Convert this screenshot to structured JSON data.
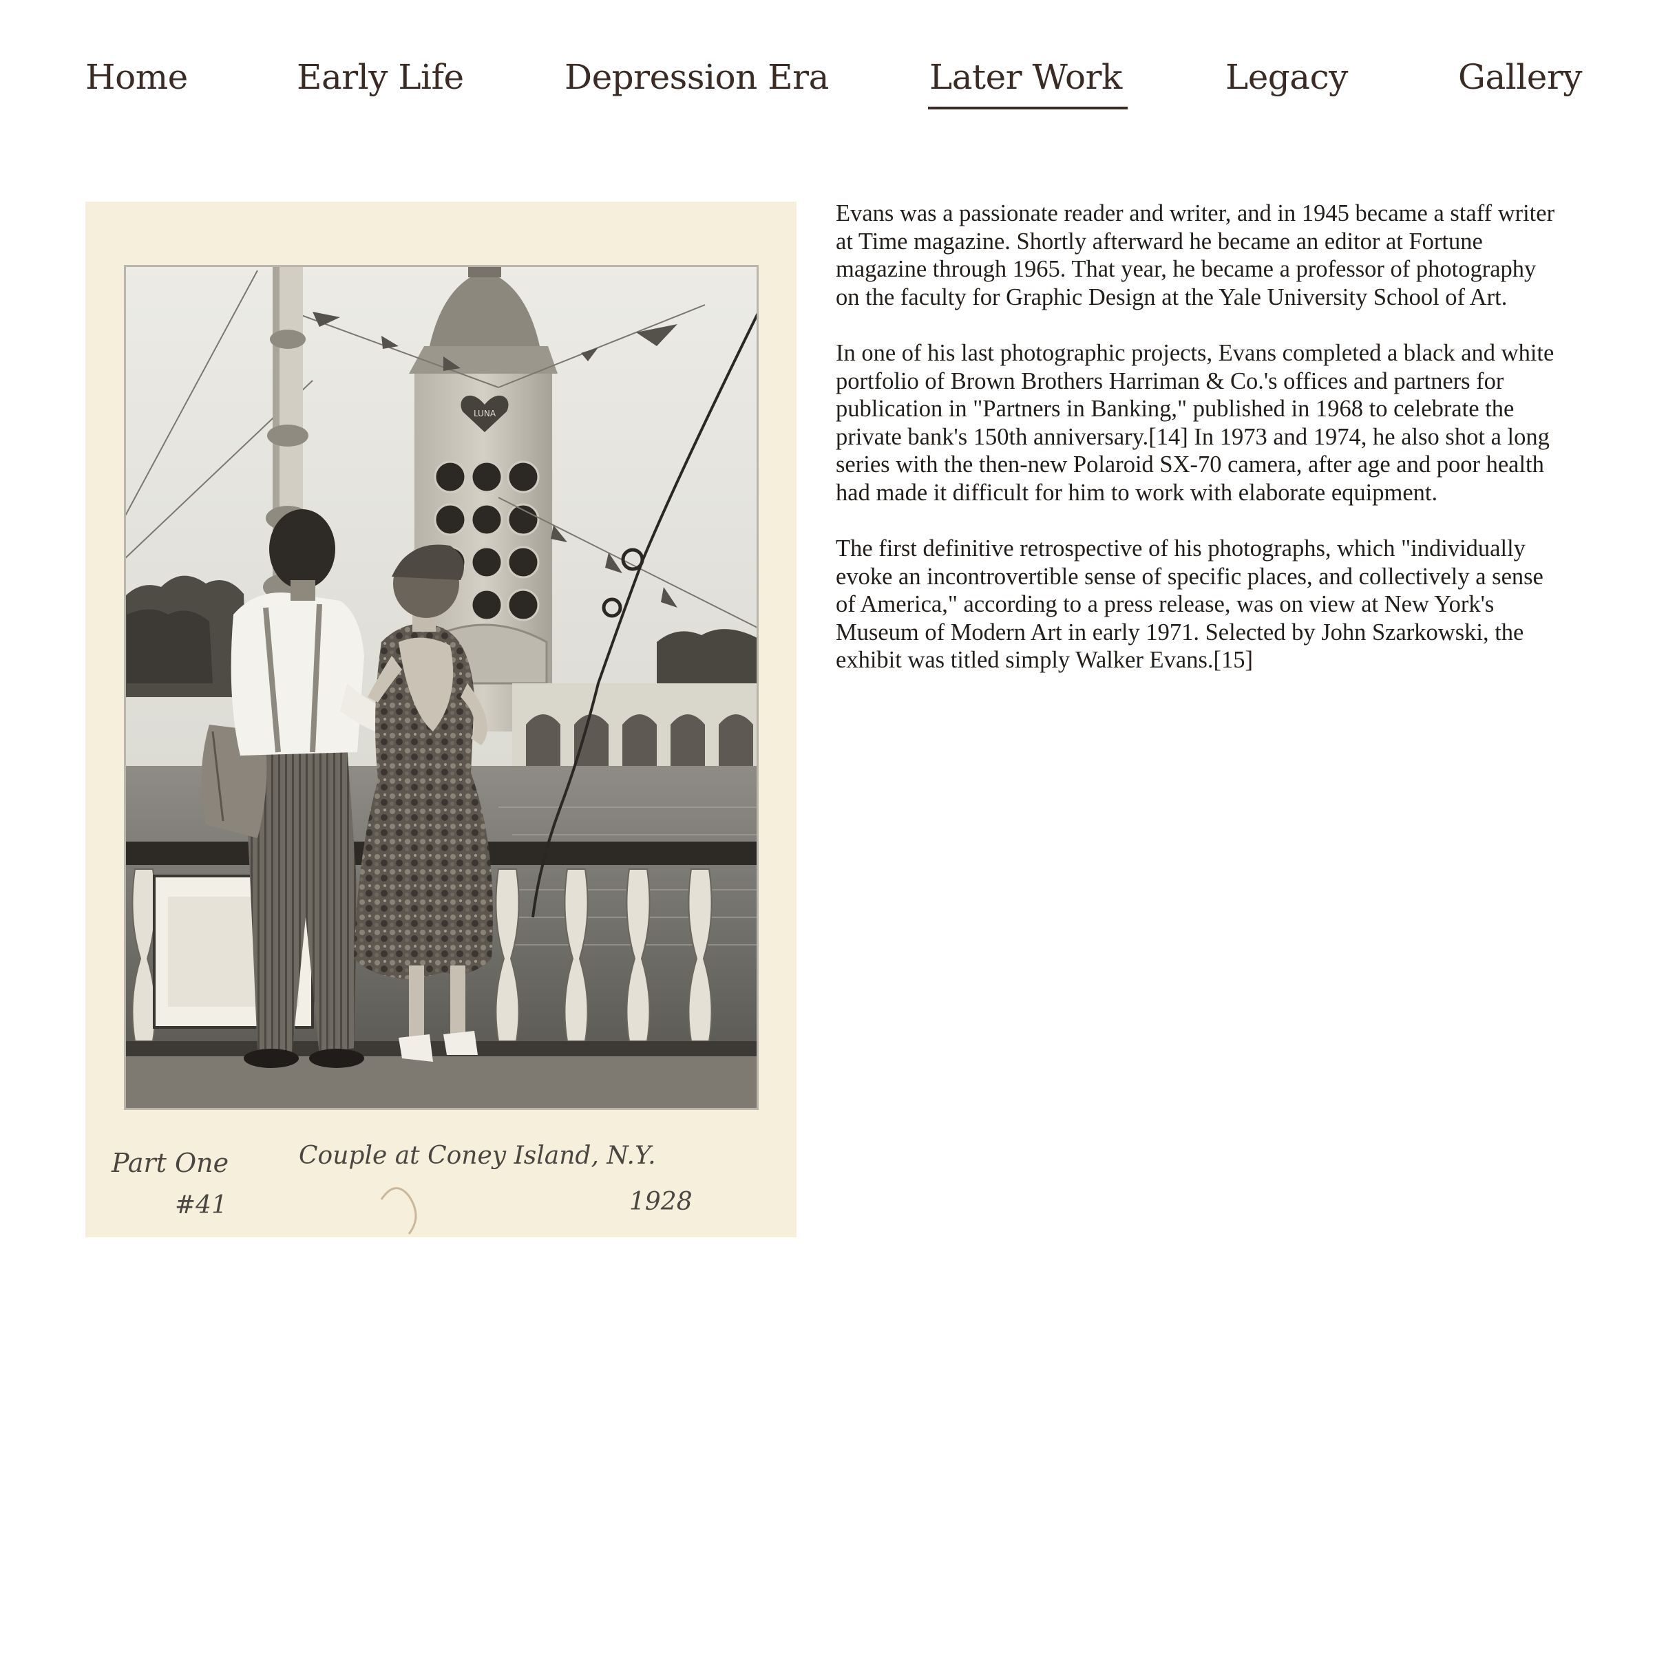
{
  "nav": {
    "items": [
      {
        "id": "home",
        "label": "Home",
        "active": false
      },
      {
        "id": "early-life",
        "label": "Early Life",
        "active": false
      },
      {
        "id": "depression-era",
        "label": "Depression Era",
        "active": false
      },
      {
        "id": "later-work",
        "label": "Later Work",
        "active": true
      },
      {
        "id": "legacy",
        "label": "Legacy",
        "active": false
      },
      {
        "id": "gallery",
        "label": "Gallery",
        "active": false
      }
    ]
  },
  "photo": {
    "inscription_left_1": "Part One",
    "inscription_left_2": "#41",
    "inscription_title": "Couple at Coney Island, N.Y.",
    "inscription_year": "1928",
    "sign_text": "LUNA"
  },
  "article": {
    "paragraphs": [
      "Evans was a passionate reader and writer, and in 1945 became a staff writer at Time magazine. Shortly afterward he became an editor at Fortune magazine through 1965. That year, he became a professor of photography on the faculty for Graphic Design at the Yale University School of Art.",
      "In one of his last photographic projects, Evans completed a black and white portfolio of Brown Brothers Harriman & Co.'s offices and partners for publication in \"Partners in Banking,\" published in 1968 to celebrate the private bank's 150th anniversary.[14] In 1973 and 1974, he also shot a long series with the then-new Polaroid SX-70 camera, after age and poor health had made it difficult for him to work with elaborate equipment.",
      "The first definitive retrospective of his photographs, which \"individually evoke an incontrovertible sense of specific places, and collectively a sense of America,\" according to a press release, was on view at New York's Museum of Modern Art in early 1971. Selected by John Szarkowski, the exhibit was titled simply Walker Evans.[15]"
    ]
  },
  "colors": {
    "nav_text": "#3a2c25",
    "body_text": "#231e1a",
    "mount_paper": "#f5efdc",
    "background": "#ffffff"
  }
}
